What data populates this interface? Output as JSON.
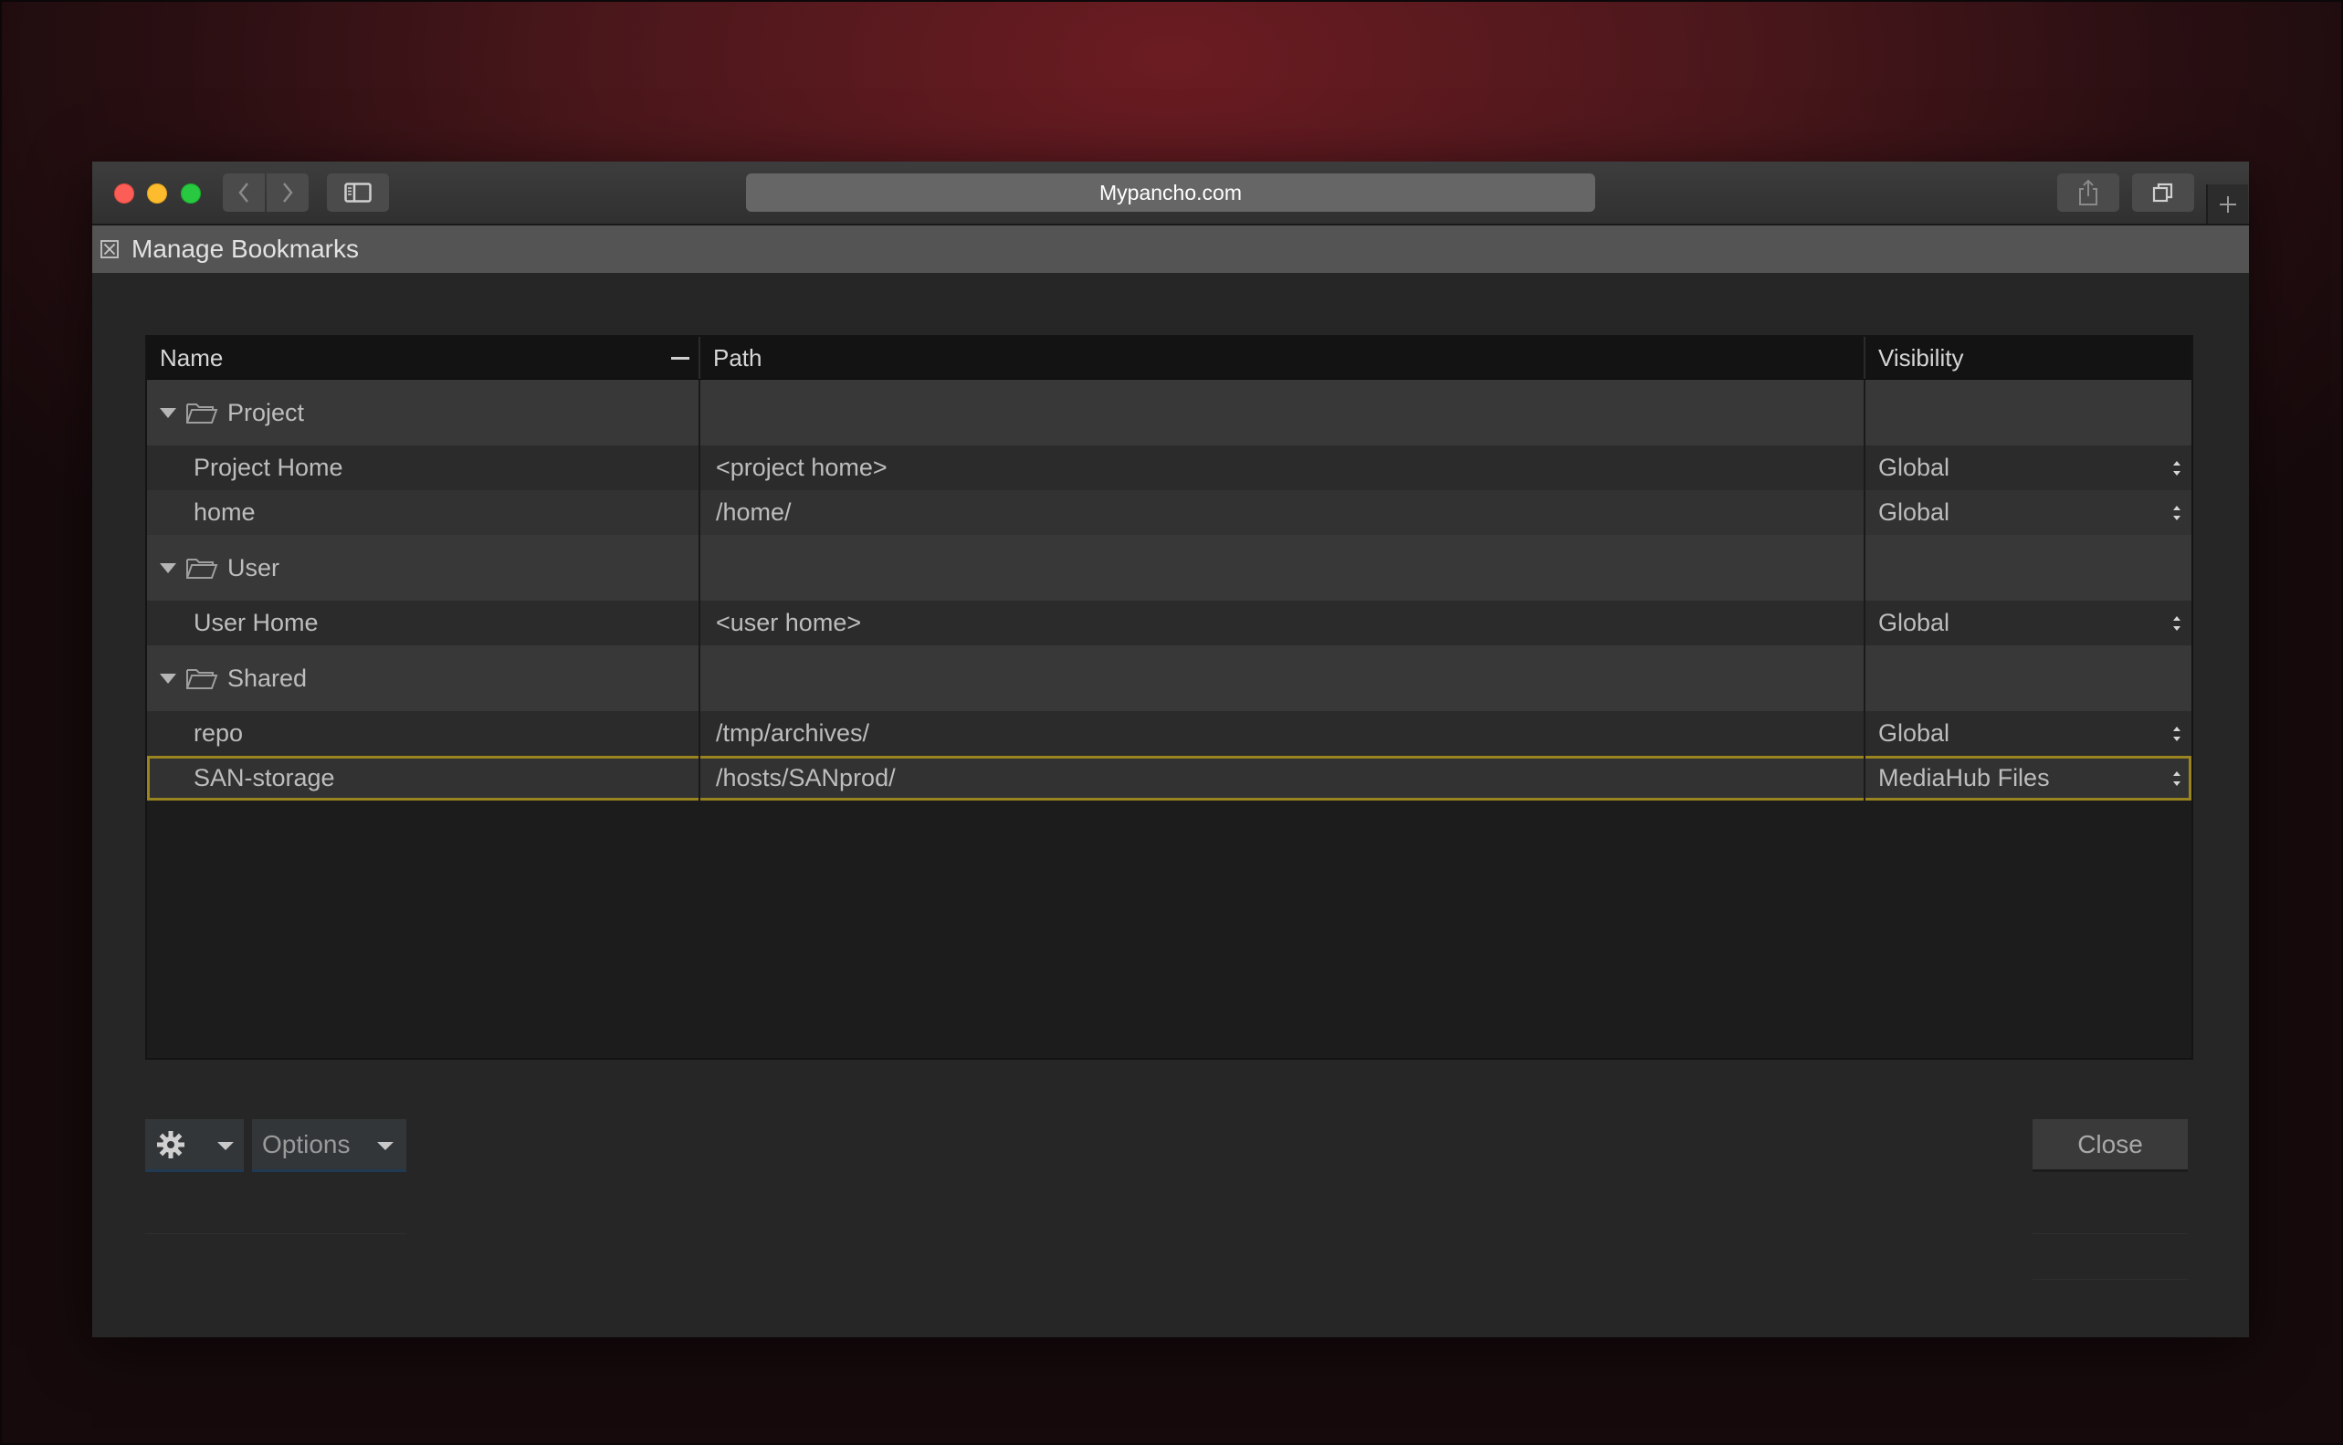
{
  "browser": {
    "url": "Mypancho.com",
    "icons": {
      "back": "chevron-left-icon",
      "forward": "chevron-right-icon",
      "sidebar": "sidebar-icon",
      "share": "share-icon",
      "tabs": "tabs-overview-icon",
      "new_tab": "plus-icon"
    }
  },
  "dialog": {
    "title": "Manage Bookmarks",
    "columns": {
      "name": "Name",
      "path": "Path",
      "visibility": "Visibility"
    },
    "groups": [
      {
        "label": "Project",
        "items": [
          {
            "name": "Project Home",
            "path": "<project home>",
            "visibility": "Global"
          },
          {
            "name": "home",
            "path": "/home/",
            "visibility": "Global"
          }
        ]
      },
      {
        "label": "User",
        "items": [
          {
            "name": "User Home",
            "path": "<user home>",
            "visibility": "Global"
          }
        ]
      },
      {
        "label": "Shared",
        "items": [
          {
            "name": "repo",
            "path": "/tmp/archives/",
            "visibility": "Global"
          },
          {
            "name": "SAN-storage",
            "path": "/hosts/SANprod/",
            "visibility": "MediaHub Files",
            "selected": true
          }
        ]
      }
    ],
    "footer": {
      "options_label": "Options",
      "close_label": "Close"
    }
  },
  "colors": {
    "selection_outline": "#9a8420",
    "button_accent": "#1f3a52",
    "background_red": "#6b1c22"
  }
}
